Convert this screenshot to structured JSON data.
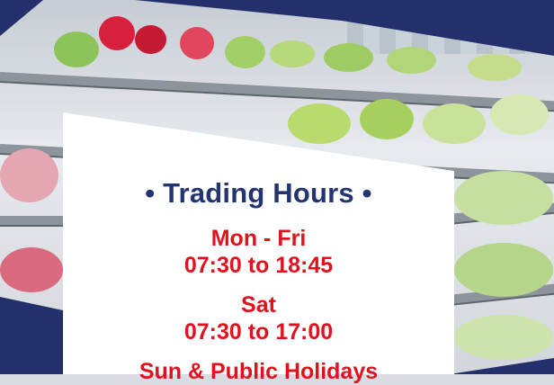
{
  "hours": {
    "title": "• Trading Hours •",
    "entries": [
      {
        "day": "Mon - Fri",
        "time": "07:30 to 18:45"
      },
      {
        "day": "Sat",
        "time": "07:30 to 17:00"
      },
      {
        "day": "Sun & Public Holidays",
        "time": ""
      }
    ]
  },
  "colors": {
    "navy": "#23306b",
    "title": "#243470",
    "accent_red": "#e0121e",
    "panel": "#ffffff"
  }
}
